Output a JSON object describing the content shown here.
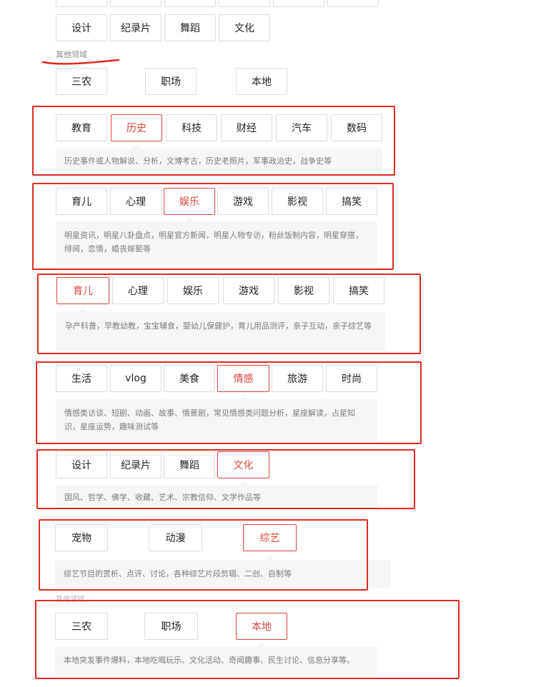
{
  "sections": {
    "other": "其他领域"
  },
  "tags": {
    "sheji": "设计",
    "jilupian": "纪录片",
    "wudao": "舞蹈",
    "wenhua": "文化",
    "sannong": "三农",
    "zhichang": "职场",
    "bendi": "本地",
    "jiaoyu": "教育",
    "lishi": "历史",
    "keji": "科技",
    "caijing": "财经",
    "qiche": "汽车",
    "shuma": "数码",
    "yuer": "育儿",
    "xinli": "心理",
    "yule": "娱乐",
    "youxi": "游戏",
    "yingshi": "影视",
    "gaoxiao": "搞笑",
    "shenghuo": "生活",
    "vlog": "vlog",
    "meishi": "美食",
    "qinggan": "情感",
    "lvyou": "旅游",
    "shishang": "时尚",
    "chongwu": "宠物",
    "dongman": "动漫",
    "zongyi": "综艺"
  },
  "descriptions": {
    "lishi": "历史事件或人物解说、分析，文博考古，历史老照片，军事政治史，战争史等",
    "yule": "明星资讯，明星八卦盘点，明星官方新闻，明星人物专访，粉丝饭制内容，明星穿搭，绯闻，恋情，婚丧嫁娶等",
    "yuer": "孕产科普，早教幼教，宝宝辅食，婴幼儿保健护，育儿用品测评，亲子互动，亲子综艺等",
    "qinggan": "情感类访谈、短剧、动画、故事、情景剧，常见情感类问题分析，星座解读，占星知识，星座运势，趣味测试等",
    "wenhua": "国风、哲学、佛学、收藏、艺术、宗教信仰、文学作品等",
    "zongyi": "综艺节目的赏析、点评、讨论，各种综艺片段剪辑、二创、自制等",
    "bendi": "本地突发事件爆料，本地吃喝玩乐、文化活动、奇闻趣事、民生讨论、信息分享等。"
  },
  "colors": {
    "accent": "#d9443d",
    "annotation": "#e02b21"
  }
}
